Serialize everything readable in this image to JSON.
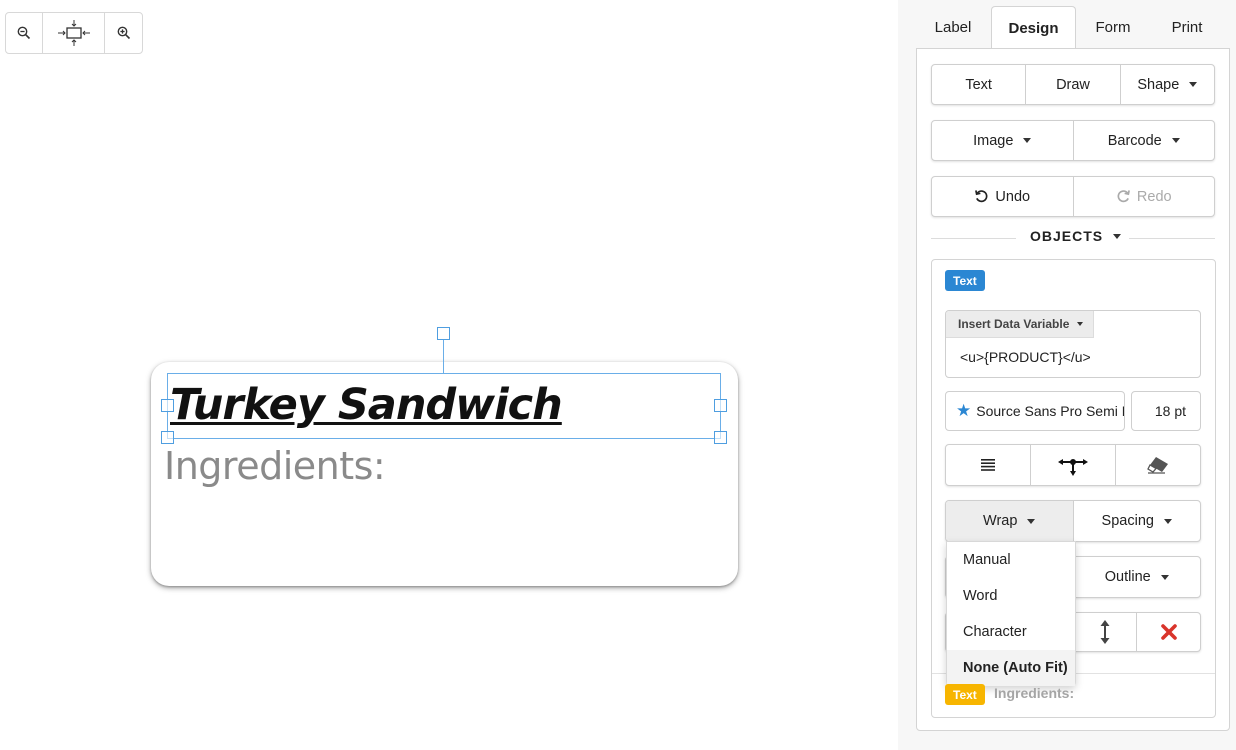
{
  "canvas": {
    "zoom_out_icon": "zoom-out-icon",
    "fit_icon": "fit-to-screen-icon",
    "zoom_in_icon": "zoom-in-icon",
    "label": {
      "title_text": "Turkey Sandwich",
      "ingredients_text": "Ingredients:"
    }
  },
  "tabs": [
    {
      "label": "Label",
      "active": false
    },
    {
      "label": "Design",
      "active": true
    },
    {
      "label": "Form",
      "active": false
    },
    {
      "label": "Print",
      "active": false
    }
  ],
  "toolbar": {
    "text": "Text",
    "draw": "Draw",
    "shape": "Shape",
    "image": "Image",
    "barcode": "Barcode",
    "undo": "Undo",
    "redo": "Redo"
  },
  "objects": {
    "heading": "OBJECTS",
    "selected": {
      "type_badge": "Text",
      "insert_variable_label": "Insert Data Variable",
      "content": "<u>{PRODUCT}</u>",
      "font_name": "Source Sans Pro Semi Bold",
      "font_size": "18 pt",
      "wrap_label": "Wrap",
      "spacing_label": "Spacing",
      "outline_label": "Outline",
      "wrap_options": [
        "Manual",
        "Word",
        "Character",
        "None (Auto Fit)"
      ],
      "wrap_selected": "None (Auto Fit)"
    },
    "second": {
      "type_badge": "Text",
      "content": "Ingredients:"
    }
  },
  "colors": {
    "accent_blue": "#2b87d3",
    "badge_yellow": "#f7b500",
    "delete_red": "#d9342b",
    "selection_blue": "#6aaee8"
  }
}
